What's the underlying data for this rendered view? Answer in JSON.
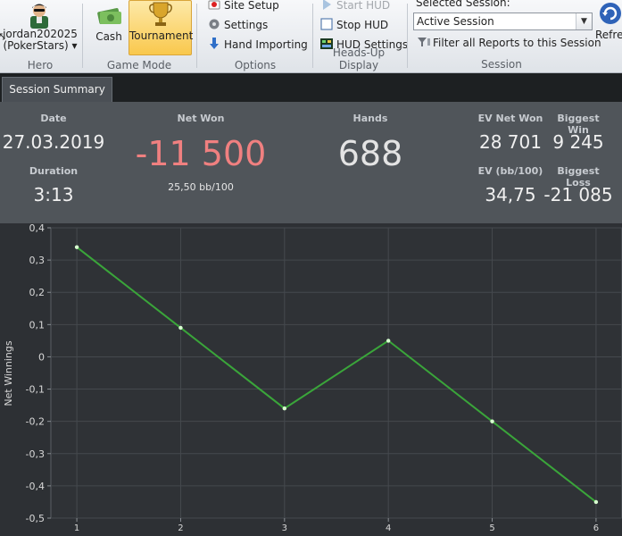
{
  "ribbon": {
    "hero": {
      "name": "jordan202025",
      "site": "(PokerStars)",
      "dropdown": "▾",
      "label": "Hero"
    },
    "game_mode": {
      "cash": "Cash",
      "tournament": "Tournament",
      "label": "Game Mode"
    },
    "options": {
      "site_setup": "Site Setup",
      "settings": "Settings",
      "hand_importing": "Hand Importing",
      "label": "Options"
    },
    "hud": {
      "start": "Start HUD",
      "stop": "Stop HUD",
      "settings": "HUD Settings",
      "label": "Heads-Up Display"
    },
    "session": {
      "caption": "Selected Session:",
      "selected": "Active Session",
      "filter": "Filter all Reports to this Session",
      "label": "Session"
    },
    "refresh": "Refresh"
  },
  "tabs": [
    {
      "label": "Session Summary"
    }
  ],
  "summary": {
    "date_label": "Date",
    "date": "27.03.2019",
    "duration_label": "Duration",
    "duration": "3:13",
    "net_won_label": "Net Won",
    "net_won": "-11 500",
    "net_won_bb": "25,50 bb/100",
    "hands_label": "Hands",
    "hands": "688",
    "ev_net_won_label": "EV Net Won",
    "ev_net_won": "28 701",
    "ev_bb_label": "EV (bb/100)",
    "ev_bb": "34,75",
    "biggest_win_label": "Biggest Win",
    "biggest_win": "9 245",
    "biggest_loss_label": "Biggest Loss",
    "biggest_loss": "-21 085"
  },
  "colors": {
    "negative": "#f08080",
    "line": "#3aa53a",
    "point": "#d8ffd0"
  },
  "chart_data": {
    "type": "line",
    "x": [
      1,
      2,
      3,
      4,
      5,
      6
    ],
    "series": [
      {
        "values": [
          0.34,
          0.09,
          -0.16,
          0.05,
          -0.2,
          -0.45
        ]
      }
    ],
    "ylabel": "Net Winnings",
    "xlim": [
      0.75,
      6.25
    ],
    "ylim": [
      -0.5,
      0.4
    ],
    "y_ticks": [
      "0,4",
      "0,3",
      "0,2",
      "0,1",
      "0",
      "-0,1",
      "-0,2",
      "-0,3",
      "-0,4",
      "-0,5"
    ],
    "x_ticks": [
      "1",
      "2",
      "3",
      "4",
      "5",
      "6"
    ],
    "grid": true
  }
}
